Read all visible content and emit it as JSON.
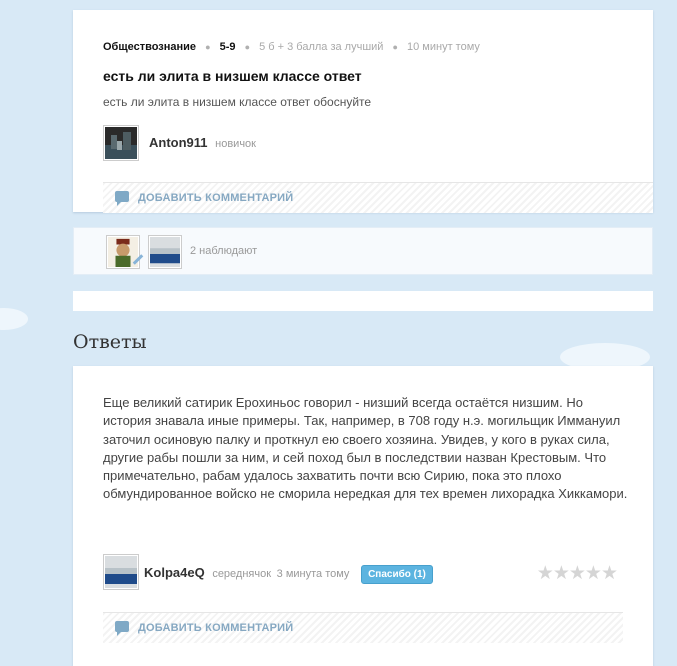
{
  "question": {
    "subject": "Обществознание",
    "grade": "5-9",
    "points": "5 б + 3 балла за лучший",
    "time": "10 минут тому",
    "title": "есть ли элита в низшем классе ответ",
    "text": "есть ли элита в низшем классе ответ обоснуйте",
    "author": "Anton911",
    "author_rank": "новичок",
    "add_comment": "ДОБАВИТЬ КОММЕНТАРИЙ"
  },
  "watchers": {
    "text": "2 наблюдают"
  },
  "answers": {
    "title": "Ответы",
    "items": [
      {
        "text": "Еще великий сатирик Ерохиньос говорил - низший всегда остаётся низшим. Но история знавала иные примеры. Так, например, в 708 году н.э. могильщик Иммануил заточил осиновую палку и проткнул ею своего хозяина. Увидев, у кого в руках сила, другие рабы пошли за ним, и сей поход был в последствии назван Крестовым. Что примечательно, рабам удалось захватить почти всю Сирию, пока это плохо обмундированное войско не сморила нередкая для тех времен лихорадка Хиккамори.",
        "author": "Kolpa4eQ",
        "author_rank": "середнячок",
        "time": "3 минута тому",
        "thanks": "Спасибо (1)",
        "rating_stars": 0,
        "add_comment": "ДОБАВИТЬ КОММЕНТАРИЙ"
      }
    ]
  },
  "colors": {
    "background": "#d8e9f6",
    "link": "#86a8c2",
    "thanks": "#5cb4e0"
  }
}
